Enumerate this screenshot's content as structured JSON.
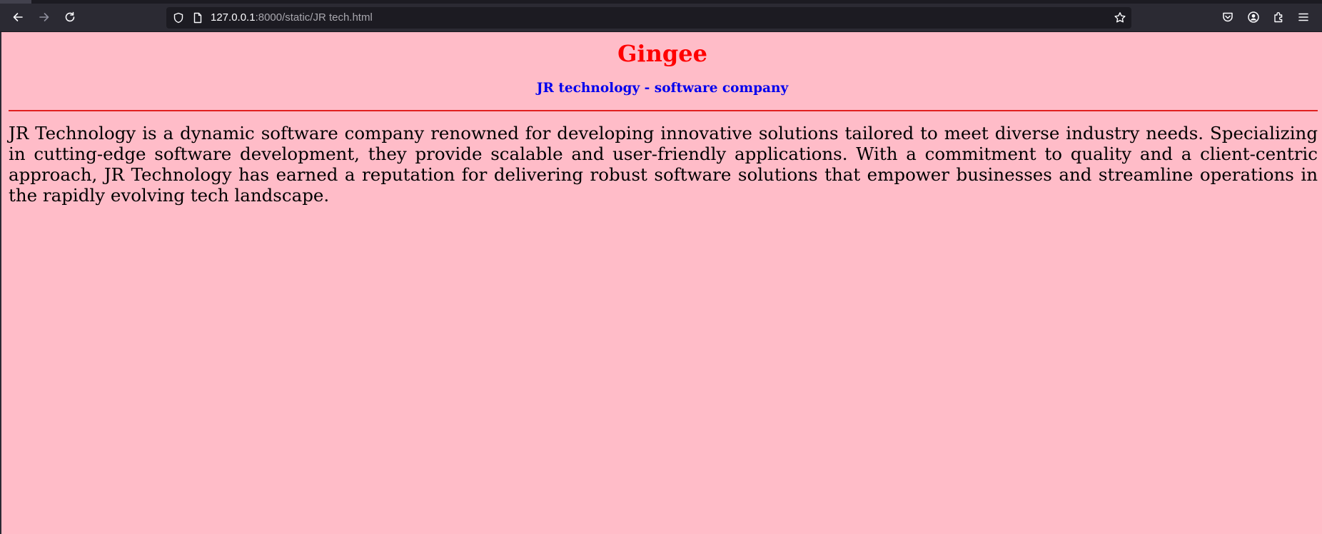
{
  "browser": {
    "url_host": "127.0.0.1",
    "url_rest": ":8000/static/JR tech.html",
    "icons": [
      "back-icon",
      "forward-icon",
      "reload-icon",
      "shield-icon",
      "page-icon",
      "bookmark-star-icon",
      "pocket-icon",
      "account-icon",
      "extensions-icon",
      "menu-icon"
    ]
  },
  "page": {
    "title": "Gingee",
    "subtitle": "JR technology - software company",
    "description": "JR Technology is a dynamic software company renowned for developing innovative solutions tailored to meet diverse industry needs. Specializing in cutting-edge software development, they provide scalable and user-friendly applications. With a commitment to quality and a client-centric approach, JR Technology has earned a reputation for delivering robust software solutions that empower businesses and streamline operations in the rapidly evolving tech landscape."
  },
  "colors": {
    "background": "#ffbcc8",
    "title": "#ff0000",
    "subtitle": "#0000ee",
    "divider": "#e02020",
    "browser_chrome": "#2b2a33"
  }
}
